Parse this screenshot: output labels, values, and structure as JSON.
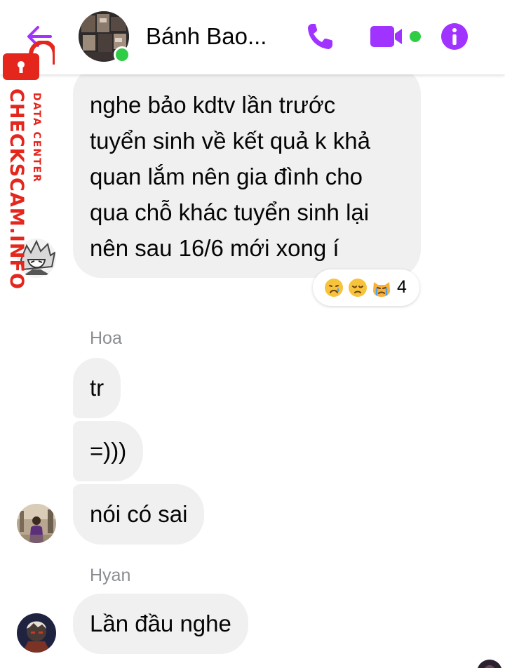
{
  "header": {
    "contact_name": "Bánh Bao...",
    "online": true,
    "accent_color": "#a033ff",
    "online_color": "#31cc46",
    "icons": [
      "back-arrow-icon",
      "phone-icon",
      "video-camera-icon",
      "info-icon"
    ]
  },
  "watermark": {
    "site": "CHECKSCAM.INFO",
    "tagline": "DATA CENTER",
    "color": "#e4261d"
  },
  "messages": [
    {
      "lines": [
        "nghe bảo kdtv lần trước",
        "tuyển sinh về kết quả k khả",
        "quan lắm nên gia đình cho",
        "qua chỗ khác tuyển sinh lại",
        "nên sau 16/6 mới xong í"
      ],
      "reactions": {
        "emojis": [
          "crying-face",
          "disappointed-face",
          "crying-cat-face"
        ],
        "count": "4"
      }
    },
    {
      "sender": "Hoa",
      "bubbles": [
        "tr",
        "=)))",
        "nói có sai"
      ]
    },
    {
      "sender": "Hyan",
      "bubbles": [
        "Lần đầu nghe"
      ]
    }
  ]
}
